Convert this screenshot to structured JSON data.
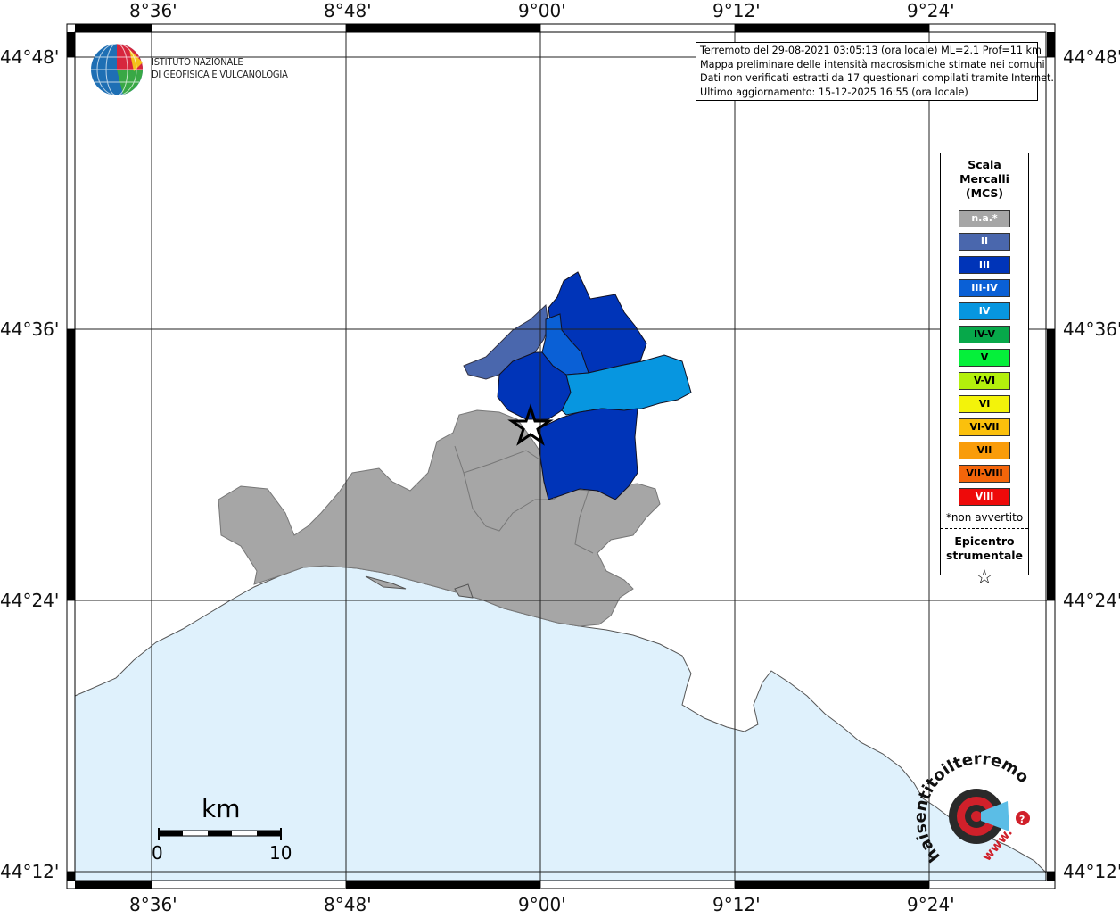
{
  "lon_labels": [
    "8°36'",
    "8°48'",
    "9°00'",
    "9°12'",
    "9°24'"
  ],
  "lat_labels": [
    "44°48'",
    "44°36'",
    "44°24'",
    "44°12'"
  ],
  "info": {
    "line1": "Terremoto del 29-08-2021 03:05:13 (ora locale) ML=2.1 Prof=11 km",
    "line2": "Mappa preliminare delle intensità macrosismiche stimate nei comuni",
    "line3": "Dati non verificati estratti da 17 questionari compilati tramite Internet.",
    "line4": "Ultimo aggiornamento: 15-12-2025 16:55 (ora locale)"
  },
  "logo": {
    "line1": "ISTITUTO NAZIONALE",
    "line2": "DI GEOFISICA E VULCANOLOGIA",
    "hst_text": "haisentitoilterremoto.it",
    "www_text": "www."
  },
  "legend": {
    "title_1": "Scala",
    "title_2": "Mercalli",
    "title_3": "(MCS)",
    "items": [
      {
        "label": "n.a.*",
        "color": "#a6a6a6",
        "dark": false
      },
      {
        "label": "II",
        "color": "#4a67ad",
        "dark": false
      },
      {
        "label": "III",
        "color": "#0034b8",
        "dark": false
      },
      {
        "label": "III-IV",
        "color": "#0a60d6",
        "dark": false
      },
      {
        "label": "IV",
        "color": "#0796e0",
        "dark": false
      },
      {
        "label": "IV-V",
        "color": "#07a84a",
        "dark": true
      },
      {
        "label": "V",
        "color": "#05f03a",
        "dark": true
      },
      {
        "label": "V-VI",
        "color": "#b3f00c",
        "dark": true
      },
      {
        "label": "VI",
        "color": "#f3f30a",
        "dark": true
      },
      {
        "label": "VI-VII",
        "color": "#fbc00c",
        "dark": true
      },
      {
        "label": "VII",
        "color": "#f99c0a",
        "dark": true
      },
      {
        "label": "VII-VIII",
        "color": "#f4650a",
        "dark": true
      },
      {
        "label": "VIII",
        "color": "#ee0a0a",
        "dark": false
      }
    ],
    "note": "*non avvertito",
    "epi_1": "Epicentro",
    "epi_2": "strumentale",
    "star_symbol": "☆"
  },
  "scale": {
    "unit": "km",
    "min": "0",
    "max": "10"
  },
  "colors": {
    "sea": "#dff1fc",
    "land": "#ffffff",
    "na": "#a6a6a6",
    "ii": "#4a67ad",
    "iii": "#0034b8",
    "iii_iv": "#0a60d6",
    "iv": "#0796e0"
  }
}
